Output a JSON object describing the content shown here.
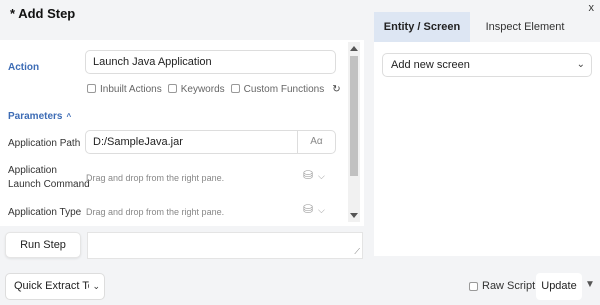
{
  "dialog": {
    "title": "* Add Step",
    "close_label": "x"
  },
  "action": {
    "label": "Action",
    "value": "Launch Java Application"
  },
  "options": {
    "inbuilt": "Inbuilt Actions",
    "keywords": "Keywords",
    "custom": "Custom Functions",
    "refresh_glyph": "↻"
  },
  "parameters": {
    "label": "Parameters",
    "caret": "^"
  },
  "application_path": {
    "label": "Application Path",
    "value": "D:/SampleJava.jar",
    "format_label": "Aα"
  },
  "launch_command": {
    "label_line1": "Application",
    "label_line2": "Launch Command",
    "hint": "Drag and drop from the right pane."
  },
  "application_type": {
    "label": "Application Type",
    "hint": "Drag and drop from the right pane."
  },
  "tabs": [
    {
      "label": "Entity / Screen",
      "active": true
    },
    {
      "label": "Inspect Element",
      "active": false
    }
  ],
  "screen_select": {
    "value": "Add new screen"
  },
  "run_step": {
    "label": "Run Step"
  },
  "footer": {
    "quick_extract": "Quick Extract To",
    "raw_script": "Raw Script",
    "update": "Update"
  }
}
